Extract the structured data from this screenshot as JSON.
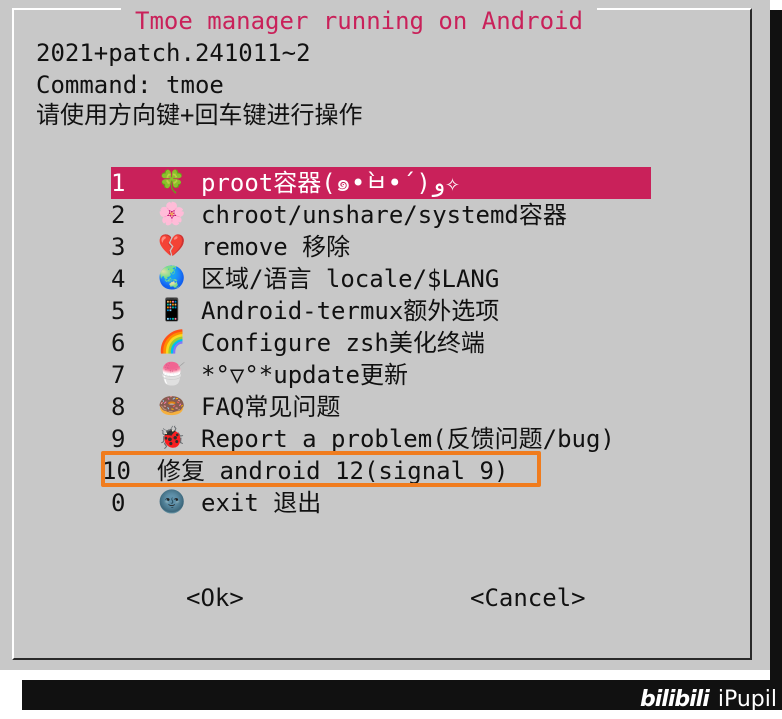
{
  "dialog": {
    "title": "Tmoe manager running on Android",
    "version": "2021+patch.241011~2",
    "command": "Command: tmoe",
    "instruction": "请使用方向键+回车键进行操作"
  },
  "menu": {
    "items": [
      {
        "num": "1",
        "icon": "four-leaf-clover-icon",
        "glyph": "🍀",
        "label": "proot容器(๑•̀ㅂ•́)و✧",
        "selected": true
      },
      {
        "num": "2",
        "icon": "cherry-blossom-icon",
        "glyph": "🌸",
        "label": "chroot/unshare/systemd容器"
      },
      {
        "num": "3",
        "icon": "broken-heart-icon",
        "glyph": "💔",
        "label": "remove 移除"
      },
      {
        "num": "4",
        "icon": "globe-icon",
        "glyph": "🌏",
        "label": "区域/语言 locale/$LANG"
      },
      {
        "num": "5",
        "icon": "mobile-phone-icon",
        "glyph": "📱",
        "label": "Android-termux额外选项"
      },
      {
        "num": "6",
        "icon": "rainbow-icon",
        "glyph": "🌈",
        "label": "Configure zsh美化终端"
      },
      {
        "num": "7",
        "icon": "shaved-ice-icon",
        "glyph": "🍧",
        "label": "*°▽°*update更新"
      },
      {
        "num": "8",
        "icon": "doughnut-icon",
        "glyph": "🍩",
        "label": "FAQ常见问题"
      },
      {
        "num": "9",
        "icon": "lady-beetle-icon",
        "glyph": "🐞",
        "label": "Report a problem(反馈问题/bug)"
      },
      {
        "num": "10",
        "icon": "",
        "glyph": "",
        "label": "修复 android 12(signal 9)"
      },
      {
        "num": "0",
        "icon": "new-moon-face-icon",
        "glyph": "🌚",
        "label": "exit 退出"
      }
    ]
  },
  "buttons": {
    "ok": "<Ok>",
    "cancel": "<Cancel>"
  },
  "watermark": {
    "logo": "bilibili",
    "user": "iPupil"
  },
  "colors": {
    "dialog_bg": "#c8c8c8",
    "accent": "#c9215a",
    "highlight_border": "#f07c1e",
    "shadow": "#111111"
  }
}
